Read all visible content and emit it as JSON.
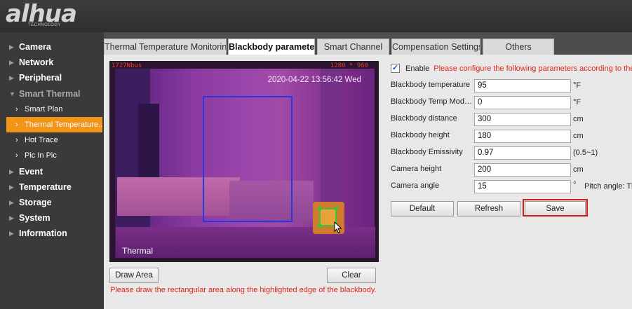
{
  "brand": {
    "logo": "alhua",
    "tagline": "TECHNOLOGY"
  },
  "sidebar": {
    "items": [
      {
        "label": "Camera"
      },
      {
        "label": "Network"
      },
      {
        "label": "Peripheral"
      },
      {
        "label": "Smart Thermal"
      },
      {
        "label": "Event"
      },
      {
        "label": "Temperature"
      },
      {
        "label": "Storage"
      },
      {
        "label": "System"
      },
      {
        "label": "Information"
      }
    ],
    "smart_thermal_sub": [
      {
        "label": "Smart Plan"
      },
      {
        "label": "Thermal Temperature..."
      },
      {
        "label": "Hot Trace"
      },
      {
        "label": "Pic In Pic"
      }
    ]
  },
  "tabs": [
    {
      "label": "Thermal Temperature Monitoring"
    },
    {
      "label": "Blackbody parameter"
    },
    {
      "label": "Smart Channel"
    },
    {
      "label": "Compensation Settings"
    },
    {
      "label": "Others"
    }
  ],
  "preview": {
    "overlay_left": "1727Nbus",
    "overlay_right": "1280 * 960",
    "timestamp": "2020-04-22 13:56:42 Wed",
    "channel_label": "Thermal"
  },
  "buttons": {
    "draw_area": "Draw Area",
    "clear": "Clear",
    "default": "Default",
    "refresh": "Refresh",
    "save": "Save"
  },
  "hint": "Please draw the rectangular area along the highlighted edge of the blackbody.",
  "form": {
    "enable_label": "Enable",
    "enable_checked": true,
    "enable_note": "Please configure the following parameters according to the latest",
    "rows": [
      {
        "label": "Blackbody temperature",
        "value": "95",
        "unit": "°F"
      },
      {
        "label": "Blackbody Temp Modification",
        "value": "0",
        "unit": "°F"
      },
      {
        "label": "Blackbody distance",
        "value": "300",
        "unit": "cm"
      },
      {
        "label": "Blackbody height",
        "value": "180",
        "unit": "cm"
      },
      {
        "label": "Blackbody Emissivity",
        "value": "0.97",
        "unit": "(0.5~1)"
      },
      {
        "label": "Camera height",
        "value": "200",
        "unit": "cm"
      },
      {
        "label": "Camera angle",
        "value": "15",
        "unit": "°"
      }
    ],
    "pitch_note": "Pitch angle: Th"
  },
  "colors": {
    "accent": "#f29418",
    "error": "#e2231a",
    "highlight": "#d8161b"
  }
}
